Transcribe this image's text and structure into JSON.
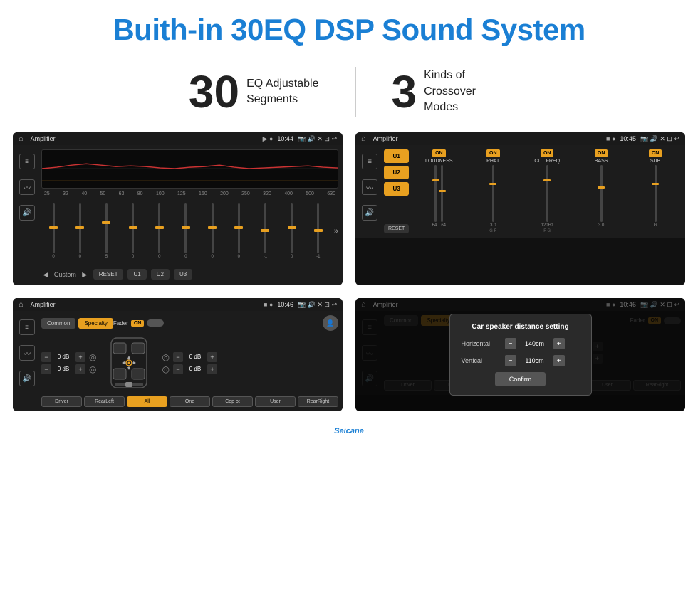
{
  "header": {
    "title": "Buith-in 30EQ DSP Sound System"
  },
  "stats": [
    {
      "number": "30",
      "desc_line1": "EQ Adjustable",
      "desc_line2": "Segments"
    },
    {
      "number": "3",
      "desc_line1": "Kinds of",
      "desc_line2": "Crossover Modes"
    }
  ],
  "screens": [
    {
      "id": "screen1",
      "statusbar": {
        "app_name": "Amplifier",
        "time": "10:44"
      },
      "type": "equalizer",
      "eq_labels": [
        "25",
        "32",
        "40",
        "50",
        "63",
        "80",
        "100",
        "125",
        "160",
        "200",
        "250",
        "320",
        "400",
        "500",
        "630"
      ],
      "sliders": [
        0,
        0,
        5,
        0,
        0,
        0,
        0,
        0,
        -1,
        0,
        -1
      ],
      "bottom_buttons": [
        "Custom",
        "RESET",
        "U1",
        "U2",
        "U3"
      ]
    },
    {
      "id": "screen2",
      "statusbar": {
        "app_name": "Amplifier",
        "time": "10:45"
      },
      "type": "crossover",
      "presets": [
        "U1",
        "U2",
        "U3"
      ],
      "channels": [
        {
          "label": "LOUDNESS",
          "on": true
        },
        {
          "label": "PHAT",
          "on": true
        },
        {
          "label": "CUT FREQ",
          "on": true
        },
        {
          "label": "BASS",
          "on": true
        },
        {
          "label": "SUB",
          "on": true
        }
      ],
      "reset_label": "RESET"
    },
    {
      "id": "screen3",
      "statusbar": {
        "app_name": "Amplifier",
        "time": "10:46"
      },
      "type": "fader",
      "tabs": [
        "Common",
        "Specialty"
      ],
      "active_tab": "Specialty",
      "fader_label": "Fader",
      "on_badge": "ON",
      "db_controls": [
        {
          "value": "0 dB"
        },
        {
          "value": "0 dB"
        },
        {
          "value": "0 dB"
        },
        {
          "value": "0 dB"
        }
      ],
      "bottom_buttons": [
        {
          "label": "Driver",
          "active": false
        },
        {
          "label": "RearLeft",
          "active": false
        },
        {
          "label": "All",
          "active": true
        },
        {
          "label": "One",
          "active": false
        },
        {
          "label": "Cop ot",
          "active": false
        },
        {
          "label": "User",
          "active": false
        },
        {
          "label": "RearRight",
          "active": false
        }
      ]
    },
    {
      "id": "screen4",
      "statusbar": {
        "app_name": "Amplifier",
        "time": "10:46"
      },
      "type": "dialog",
      "dialog_title": "Car speaker distance setting",
      "horizontal_label": "Horizontal",
      "horizontal_value": "140cm",
      "vertical_label": "Vertical",
      "vertical_value": "110cm",
      "confirm_label": "Confirm"
    }
  ],
  "watermark": "Seicane"
}
